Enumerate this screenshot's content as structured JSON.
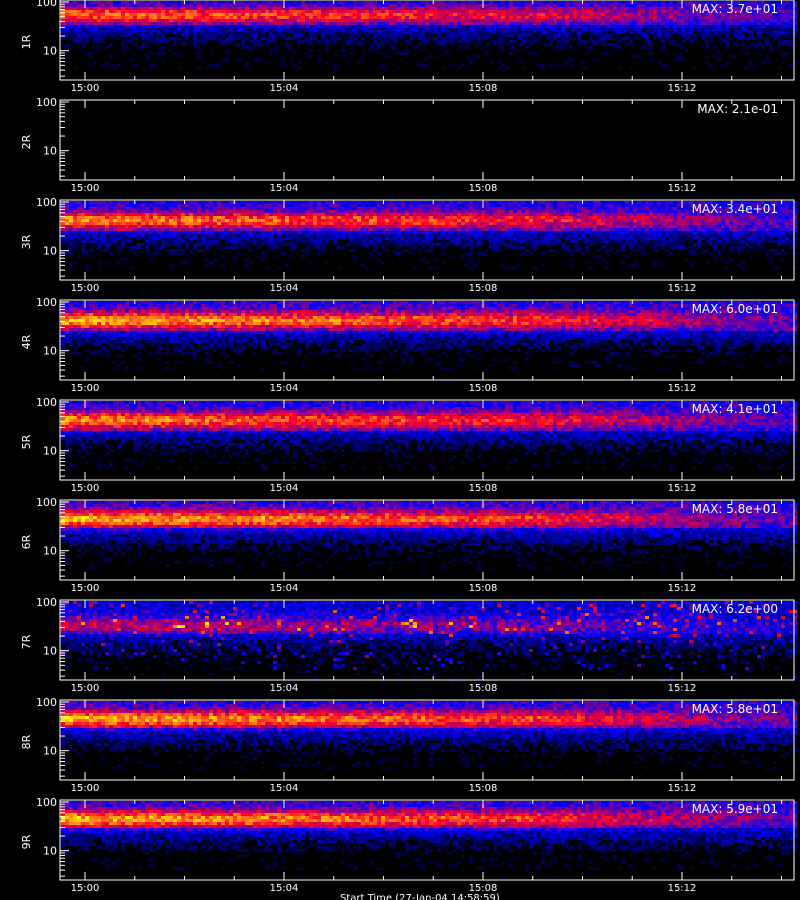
{
  "chart_data": {
    "type": "heatmap",
    "description_free": true,
    "x_ticks": [
      "15:00",
      "15:04",
      "15:08",
      "15:12"
    ],
    "x_range": [
      "14:59:00",
      "15:14:30"
    ],
    "y_scale": "log",
    "y_ticks": [
      "10",
      "100"
    ],
    "y_range": [
      2.5,
      110
    ],
    "colorscale": [
      "#000000",
      "#0000ff",
      "#ff0000",
      "#ffff00"
    ],
    "panels": [
      {
        "label": "1R",
        "max_text": "MAX: 3.7e+01",
        "max": 37,
        "band_center": 58,
        "band_strength": 0.85
      },
      {
        "label": "2R",
        "max_text": "MAX: 2.1e-01",
        "max": 0.21,
        "band_center": 58,
        "band_strength": 0.0
      },
      {
        "label": "3R",
        "max_text": "MAX: 3.4e+01",
        "max": 34,
        "band_center": 45,
        "band_strength": 0.9
      },
      {
        "label": "4R",
        "max_text": "MAX: 6.0e+01",
        "max": 60,
        "band_center": 45,
        "band_strength": 0.95
      },
      {
        "label": "5R",
        "max_text": "MAX: 4.1e+01",
        "max": 41,
        "band_center": 45,
        "band_strength": 0.9
      },
      {
        "label": "6R",
        "max_text": "MAX: 5.8e+01",
        "max": 58,
        "band_center": 48,
        "band_strength": 0.95
      },
      {
        "label": "7R",
        "max_text": "MAX: 6.2e+00",
        "max": 6.2,
        "band_center": 35,
        "band_strength": 0.8
      },
      {
        "label": "8R",
        "max_text": "MAX: 5.8e+01",
        "max": 58,
        "band_center": 48,
        "band_strength": 0.95
      },
      {
        "label": "9R",
        "max_text": "MAX: 5.9e+01",
        "max": 59,
        "band_center": 48,
        "band_strength": 0.95
      }
    ]
  },
  "footer_label": "Start Time (27-Jan-04 14:58:59)"
}
